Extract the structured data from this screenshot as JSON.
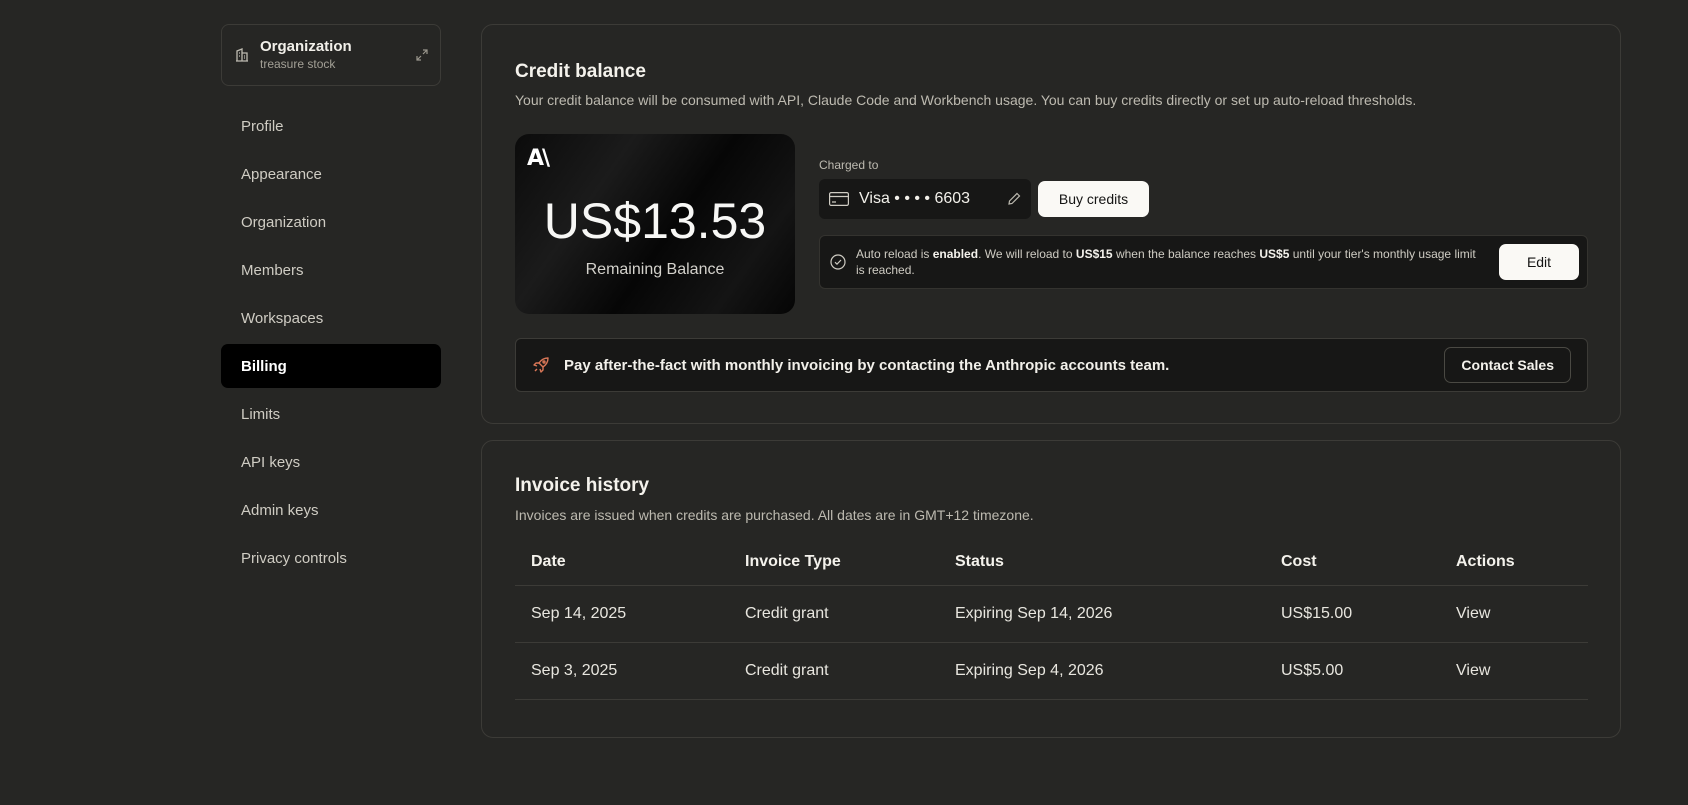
{
  "organization": {
    "title": "Organization",
    "subtitle": "treasure stock"
  },
  "nav": {
    "items": [
      {
        "label": "Profile"
      },
      {
        "label": "Appearance"
      },
      {
        "label": "Organization"
      },
      {
        "label": "Members"
      },
      {
        "label": "Workspaces"
      },
      {
        "label": "Billing",
        "active": true
      },
      {
        "label": "Limits"
      },
      {
        "label": "API keys"
      },
      {
        "label": "Admin keys"
      },
      {
        "label": "Privacy controls"
      }
    ]
  },
  "credit": {
    "title": "Credit balance",
    "description": "Your credit balance will be consumed with API, Claude Code and Workbench usage. You can buy credits directly or set up auto-reload thresholds.",
    "logo": "A\\",
    "amount": "US$13.53",
    "amount_label": "Remaining Balance",
    "charged_label": "Charged to",
    "card_text": "Visa • • • • 6603",
    "buy_label": "Buy credits",
    "reload": {
      "p1": "Auto reload is ",
      "enabled": "enabled",
      "p2": ". We will reload to ",
      "amount": "US$15",
      "p3": " when the balance reaches ",
      "threshold": "US$5",
      "p4": " until your tier's monthly usage limit is reached."
    },
    "edit_label": "Edit",
    "banner_text": "Pay after-the-fact with monthly invoicing by contacting the Anthropic accounts team.",
    "contact_label": "Contact Sales"
  },
  "invoice": {
    "title": "Invoice history",
    "description": "Invoices are issued when credits are purchased. All dates are in GMT+12 timezone.",
    "columns": [
      "Date",
      "Invoice Type",
      "Status",
      "Cost",
      "Actions"
    ],
    "rows": [
      {
        "date": "Sep 14, 2025",
        "type": "Credit grant",
        "status": "Expiring Sep 14, 2026",
        "cost": "US$15.00",
        "action": "View"
      },
      {
        "date": "Sep 3, 2025",
        "type": "Credit grant",
        "status": "Expiring Sep 4, 2026",
        "cost": "US$5.00",
        "action": "View"
      }
    ]
  },
  "colors": {
    "background": "#262624",
    "accent": "#d97757",
    "active_nav": "#000000"
  }
}
